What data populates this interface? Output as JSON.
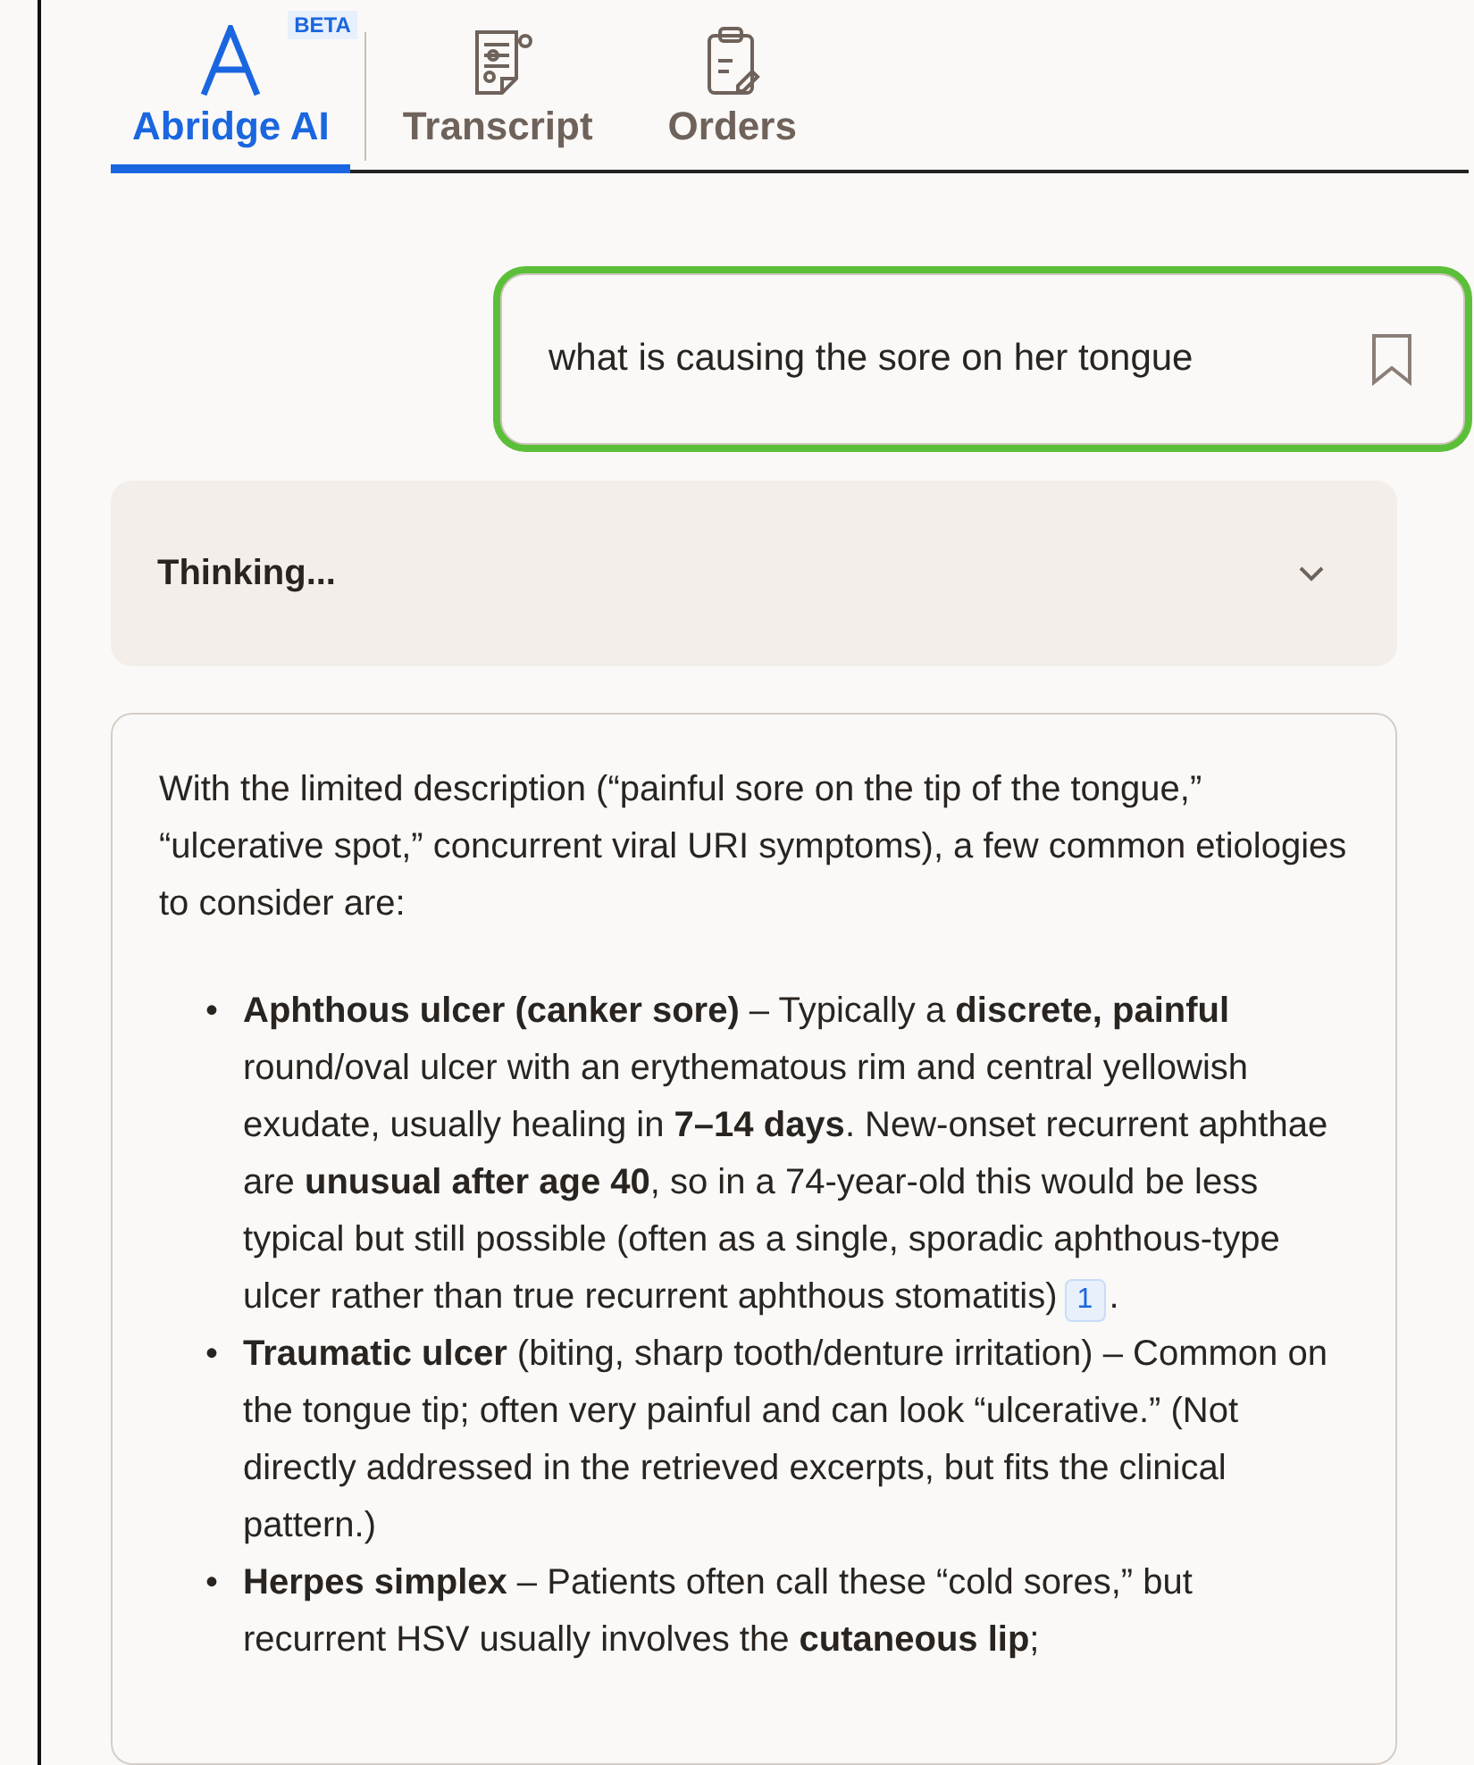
{
  "tabs": [
    {
      "label": "Abridge AI",
      "badge": "BETA",
      "selected": true
    },
    {
      "label": "Transcript",
      "selected": false
    },
    {
      "label": "Orders",
      "selected": false
    }
  ],
  "query": {
    "text": "what is causing the sore on her tongue",
    "highlighted": true
  },
  "thinking": {
    "label": "Thinking...",
    "expanded": false
  },
  "answer": {
    "intro": "With the limited description (“painful sore on the tip of the tongue,” “ulcerative spot,” concurrent viral URI symptoms), a few common etiologies to consider are:",
    "bullets": [
      {
        "marker": "•",
        "text": "**Aphthous ulcer (canker sore)** – Typically a **discrete, painful** round/oval ulcer with an erythematous rim and central yellowish exudate, usually healing in **7–14 days**. New-onset recurrent aphthae are **unusual after age 40**, so in a 74-year-old this would be less typical but still possible (often as a single, sporadic aphthous-type ulcer rather than true recurrent aphthous stomatitis)",
        "citation": "1",
        "after": "."
      },
      {
        "marker": "•",
        "text": "**Traumatic ulcer** (biting, sharp tooth/denture irritation) – Common on the tongue tip; often very painful and can look “ulcerative.” (Not directly addressed in the retrieved excerpts, but fits the clinical pattern.)"
      },
      {
        "marker": "•",
        "text": "**Herpes simplex** – Patients often call these “cold sores,” but recurrent HSV usually involves the **cutaneous lip**;"
      }
    ]
  }
}
